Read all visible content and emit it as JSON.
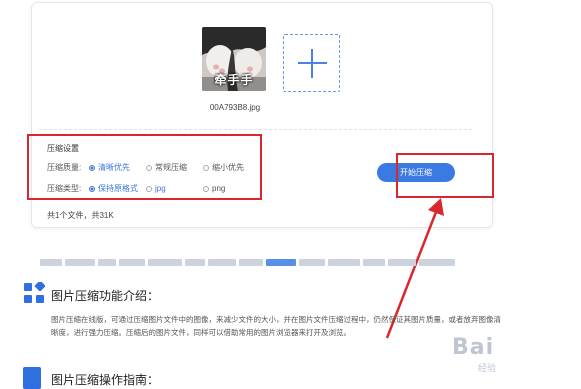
{
  "upload": {
    "thumbnail_caption": "牵手手",
    "file_name": "00A793B8.jpg",
    "add_icon": "plus-icon"
  },
  "settings": {
    "title": "压缩设置",
    "quality_label": "压缩质量:",
    "quality_options": [
      "清晰优先",
      "常规压缩",
      "缩小优先"
    ],
    "quality_selected": "清晰优先",
    "type_label": "压缩类型:",
    "type_options": [
      "保持原格式",
      "jpg",
      "png"
    ],
    "type_selected": "保持原格式"
  },
  "summary": {
    "file_count": "共1个文件，共31K"
  },
  "actions": {
    "start_label": "开始压缩"
  },
  "section_intro": {
    "icon": "apps-grid-icon",
    "title": "图片压缩功能介绍：",
    "body": "图片压缩在线版，可通过压缩图片文件中的图像，来减少文件的大小，并在图片文件压缩过程中，仍然保证其图片质量，或者放弃图像清晰度，进行强力压缩。压缩后的图片文件，同样可以借助常用的图片浏览器来打开及浏览。"
  },
  "section_guide": {
    "icon": "book-icon",
    "title": "图片压缩操作指南："
  },
  "watermark": {
    "text": "Bai",
    "sub": "经验"
  },
  "colors": {
    "accent": "#3b79e3",
    "annotation_red": "#d9282d"
  }
}
